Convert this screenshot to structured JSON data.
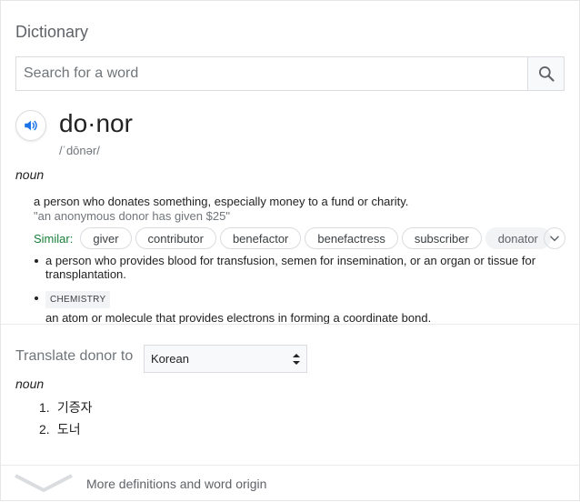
{
  "card": {
    "title": "Dictionary"
  },
  "search": {
    "placeholder": "Search for a word"
  },
  "entry": {
    "headword": "do·nor",
    "pronunciation": "/ˈdōnər/",
    "part_of_speech": "noun",
    "definition_1": "a person who donates something, especially money to a fund or charity.",
    "example_1": "\"an anonymous donor has given $25\"",
    "similar_label": "Similar:",
    "similar_words": [
      "giver",
      "contributor",
      "benefactor",
      "benefactress",
      "subscriber",
      "donator"
    ],
    "sense_2": "a person who provides blood for transfusion, semen for insemination, or an organ or tissue for transplantation.",
    "sense_3_tag": "CHEMISTRY",
    "sense_3": "an atom or molecule that provides electrons in forming a coordinate bond."
  },
  "translate": {
    "label": "Translate donor to",
    "language": "Korean",
    "part_of_speech": "noun",
    "translations": [
      {
        "num": "1.",
        "text": "기증자"
      },
      {
        "num": "2.",
        "text": "도너"
      }
    ]
  },
  "footer": {
    "more_label": "More definitions and word origin"
  },
  "colors": {
    "similar_label": "#188038",
    "speaker_icon": "#1a73e8",
    "muted_text": "#70757a"
  },
  "icons": {
    "search": "search-icon",
    "speaker": "speaker-icon",
    "expand": "chevron-down-icon",
    "more": "chevron-down-icon"
  }
}
